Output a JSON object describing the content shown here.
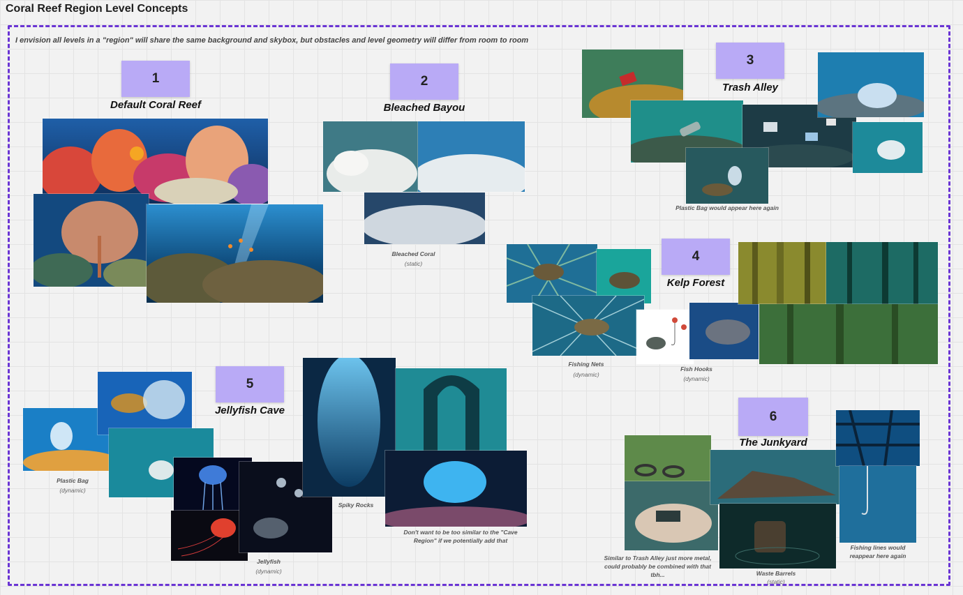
{
  "board": {
    "title": "Coral Reef Region Level Concepts",
    "intro": "I envision all levels in a \"region\" will share the same background and skybox, but obstacles and level geometry will differ from room to room"
  },
  "colors": {
    "frame": "#6a34d4",
    "sticky": "#b9aaf6",
    "canvas": "#f2f2f2"
  },
  "levels": [
    {
      "number": "1",
      "title": "Default Coral Reef"
    },
    {
      "number": "2",
      "title": "Bleached Bayou"
    },
    {
      "number": "3",
      "title": "Trash Alley"
    },
    {
      "number": "4",
      "title": "Kelp Forest"
    },
    {
      "number": "5",
      "title": "Jellyfish Cave"
    },
    {
      "number": "6",
      "title": "The Junkyard"
    }
  ],
  "captions": {
    "bleached_coral": "Bleached Coral",
    "bleached_coral_sub": "(static)",
    "plastic_bag_again": "Plastic Bag would appear here again",
    "fishing_nets": "Fishing Nets",
    "fishing_nets_sub": "(dynamic)",
    "fish_hooks": "Fish Hooks",
    "fish_hooks_sub": "(dynamic)",
    "plastic_bag": "Plastic Bag",
    "plastic_bag_sub": "(dynamic)",
    "spiky_rocks": "Spiky Rocks",
    "jellyfish": "Jellyfish",
    "jellyfish_sub": "(dynamic)",
    "cave_region_note": "Don't want to be too similar to the \"Cave Region\" if we potentially add that",
    "junkyard_note": "Similar to Trash Alley just more metal, could probably be combined with that tbh...",
    "waste_barrels": "Waste Barrels",
    "waste_barrels_sub": "(static)",
    "fishing_lines": "Fishing lines would reappear here again"
  }
}
